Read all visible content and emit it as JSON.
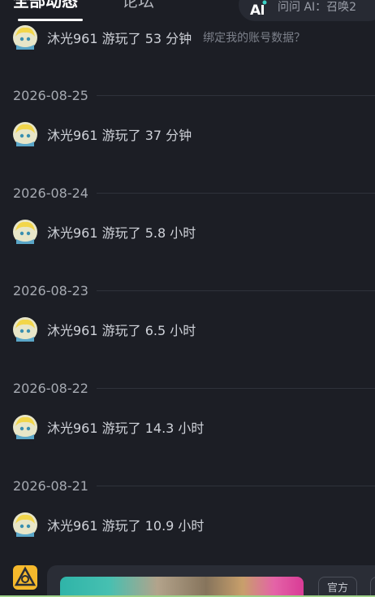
{
  "tabs": {
    "active": "全部动态",
    "inactive": "论坛"
  },
  "ai_search": {
    "label": "问问 AI：召唤2"
  },
  "feed": {
    "top_entry": {
      "text": "沐光961 游玩了 53 分钟",
      "extra": "绑定我的账号数据？"
    },
    "days": [
      {
        "date": "2026-08-25",
        "text": "沐光961 游玩了 37 分钟"
      },
      {
        "date": "2026-08-24",
        "text": "沐光961 游玩了 5.8 小时"
      },
      {
        "date": "2026-08-23",
        "text": "沐光961 游玩了 6.5 小时"
      },
      {
        "date": "2026-08-22",
        "text": "沐光961 游玩了 14.3 小时"
      },
      {
        "date": "2026-08-21",
        "text": "沐光961 游玩了 10.9 小时"
      }
    ]
  },
  "bottom_bar": {
    "tag_label": "官方"
  },
  "colors": {
    "background": "#1c1e25",
    "text_primary": "#cfd2d9",
    "accent_logo": "#f5b92c"
  }
}
